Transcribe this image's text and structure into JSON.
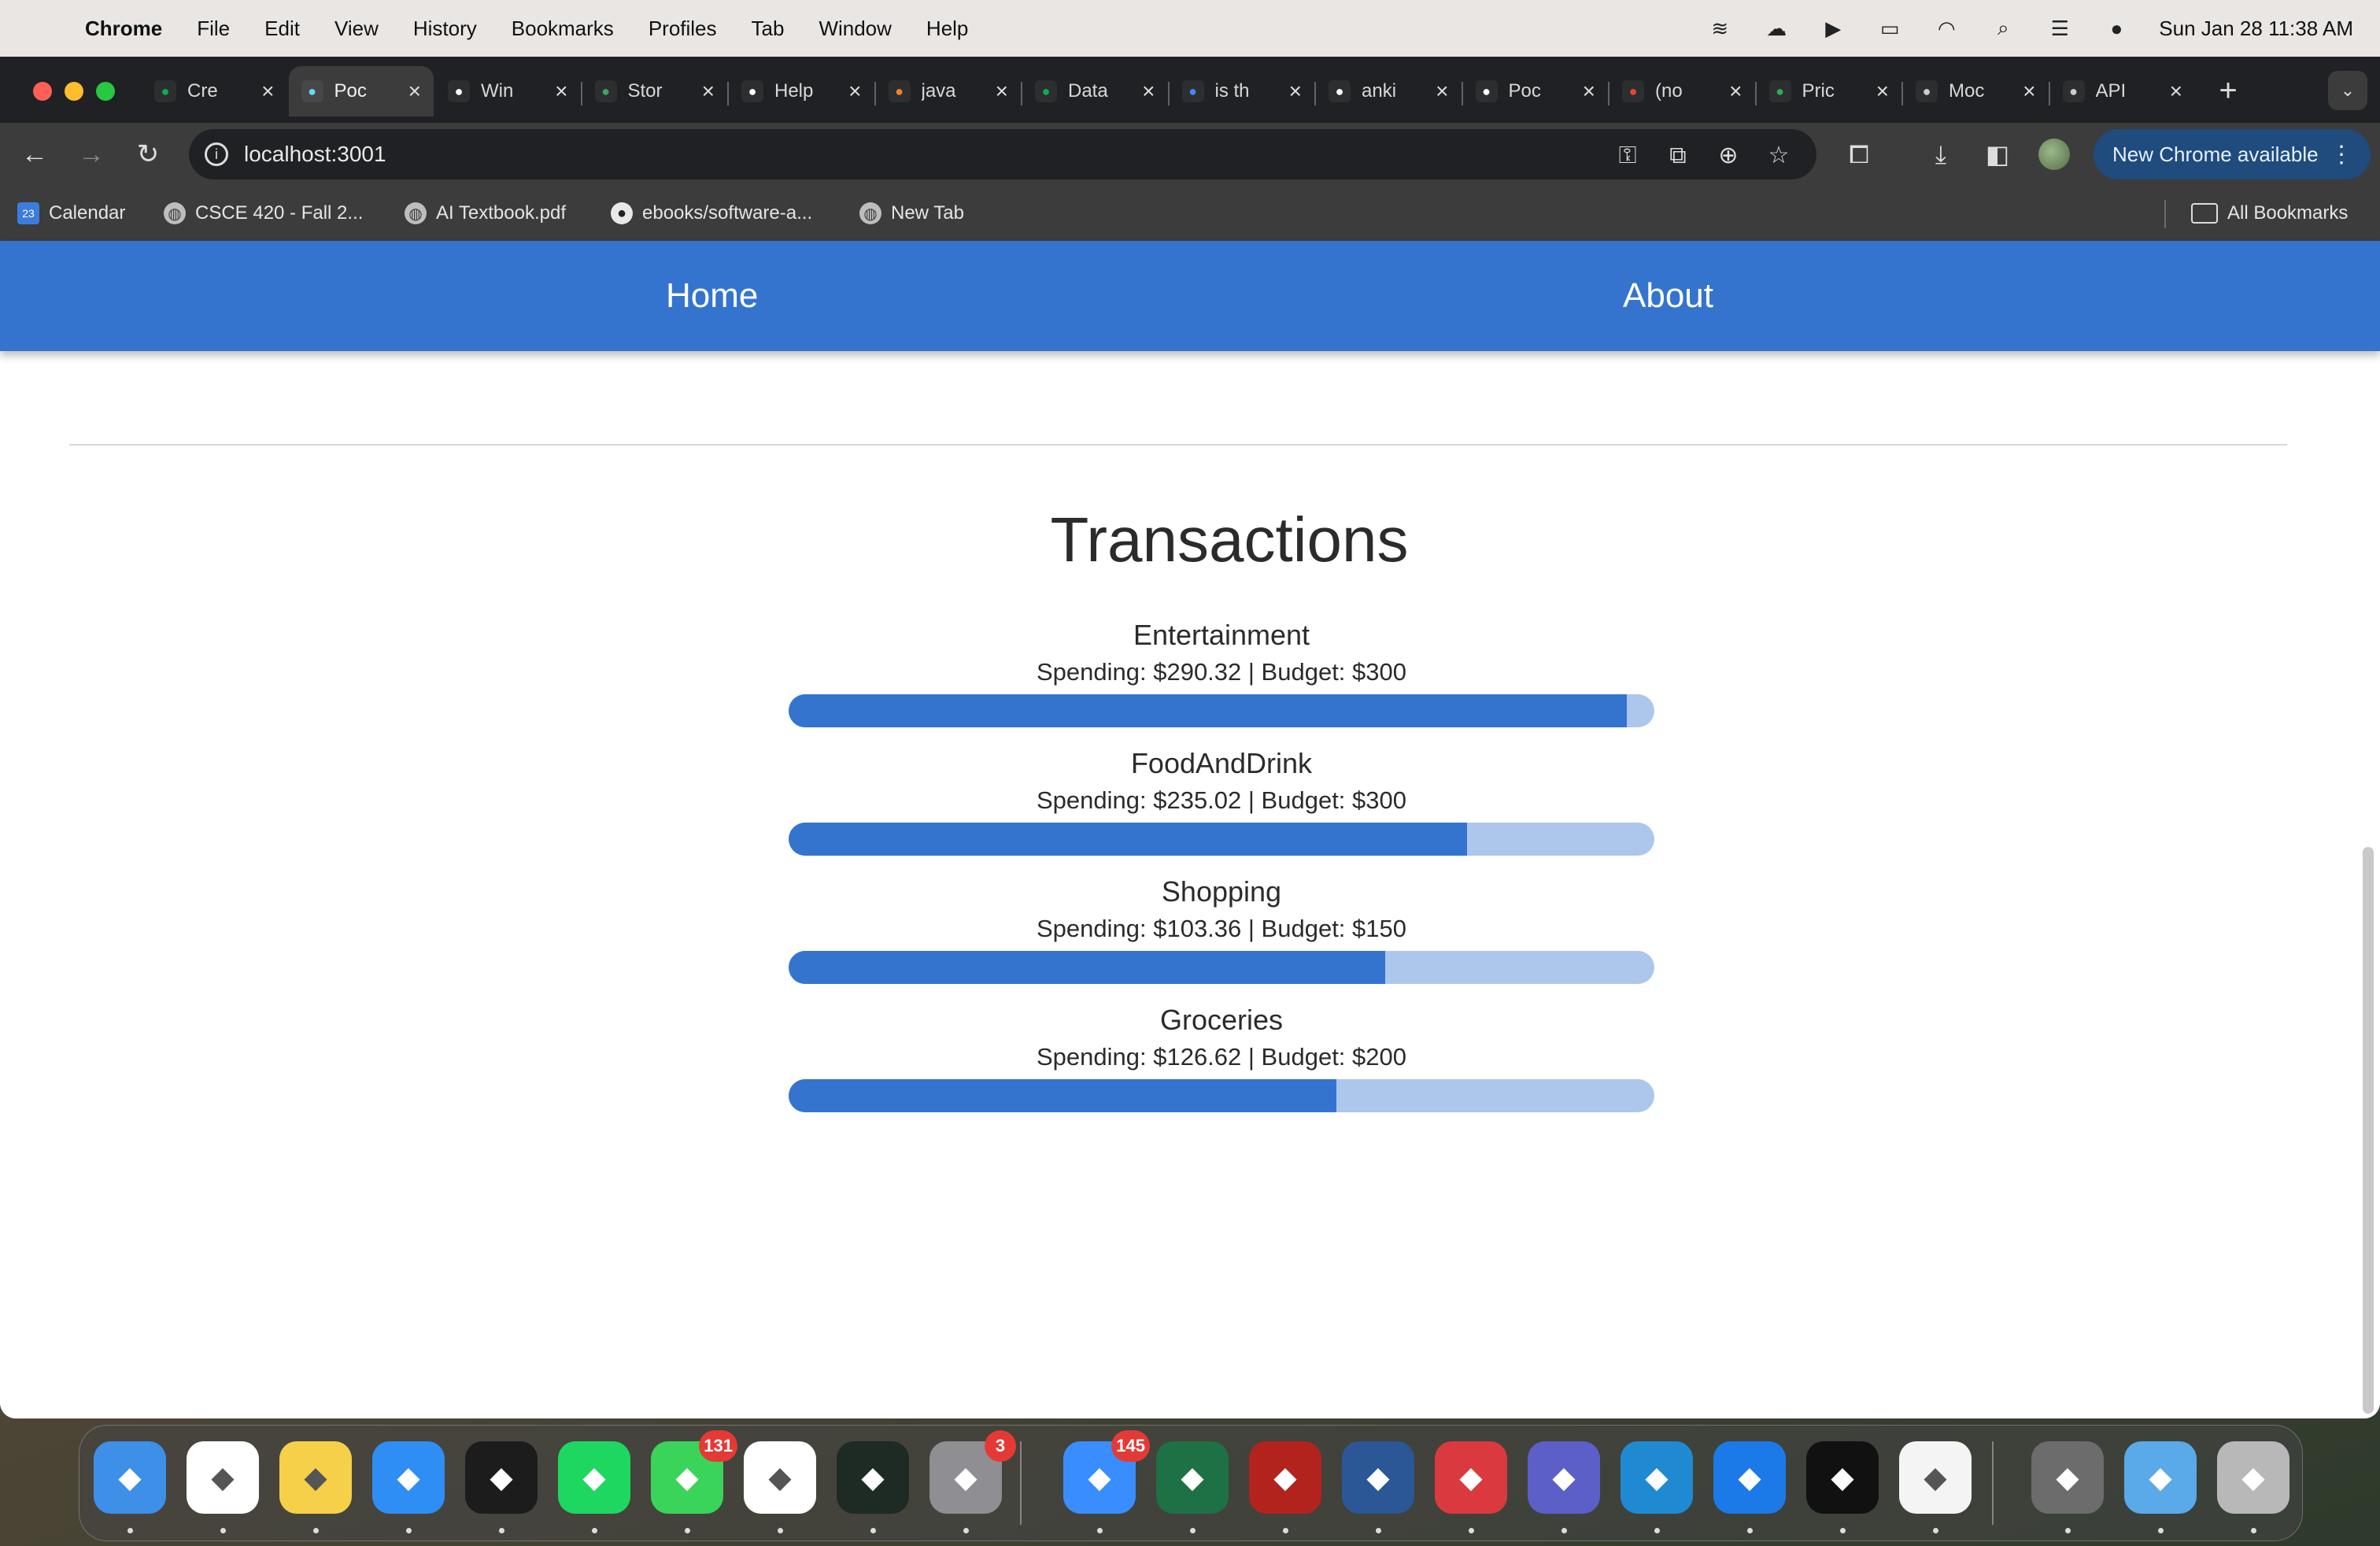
{
  "menubar": {
    "app_name": "Chrome",
    "items": [
      "File",
      "Edit",
      "View",
      "History",
      "Bookmarks",
      "Profiles",
      "Tab",
      "Window",
      "Help"
    ],
    "datetime": "Sun Jan 28  11:38 AM"
  },
  "tabs": [
    {
      "title": "Cre",
      "icon": "mongodb-leaf-icon",
      "color": "#13aa52"
    },
    {
      "title": "Poc",
      "icon": "react-icon",
      "color": "#61dafb",
      "active": true
    },
    {
      "title": "Win",
      "icon": "medium-icon",
      "color": "#ffffff"
    },
    {
      "title": "Stor",
      "icon": "w-logo-icon",
      "color": "#3da35d"
    },
    {
      "title": "Help",
      "icon": "triangle-icon",
      "color": "#ffffff"
    },
    {
      "title": "java",
      "icon": "stackoverflow-icon",
      "color": "#f48024"
    },
    {
      "title": "Data",
      "icon": "mongodb-leaf-icon",
      "color": "#13aa52"
    },
    {
      "title": "is th",
      "icon": "google-icon",
      "color": "#4285f4"
    },
    {
      "title": "anki",
      "icon": "github-icon",
      "color": "#ffffff"
    },
    {
      "title": "Poc",
      "icon": "github-icon",
      "color": "#ffffff"
    },
    {
      "title": "(no",
      "icon": "gmail-icon",
      "color": "#ea4335"
    },
    {
      "title": "Pric",
      "icon": "spreadsheet-icon",
      "color": "#34a853"
    },
    {
      "title": "Moc",
      "icon": "openai-icon",
      "color": "#cccccc"
    },
    {
      "title": "API",
      "icon": "openai-icon",
      "color": "#cccccc"
    }
  ],
  "toolbar": {
    "url": "localhost:3001",
    "update_label": "New Chrome available"
  },
  "bookmarks": [
    {
      "label": "Calendar",
      "icon": "calendar-icon"
    },
    {
      "label": "CSCE 420 - Fall 2...",
      "icon": "globe-icon"
    },
    {
      "label": "AI Textbook.pdf",
      "icon": "globe-icon"
    },
    {
      "label": "ebooks/software-a...",
      "icon": "github-icon"
    },
    {
      "label": "New Tab",
      "icon": "globe-icon"
    }
  ],
  "all_bookmarks": "All Bookmarks",
  "nav": {
    "home": "Home",
    "about": "About"
  },
  "page": {
    "title": "Transactions",
    "categories": [
      {
        "name": "Entertainment",
        "stats": "Spending: $290.32 | Budget: $300",
        "spending": 290.32,
        "budget": 300
      },
      {
        "name": "FoodAndDrink",
        "stats": "Spending: $235.02 | Budget: $300",
        "spending": 235.02,
        "budget": 300
      },
      {
        "name": "Shopping",
        "stats": "Spending: $103.36 | Budget: $150",
        "spending": 103.36,
        "budget": 150
      },
      {
        "name": "Groceries",
        "stats": "Spending: $126.62 | Budget: $200",
        "spending": 126.62,
        "budget": 200
      }
    ]
  },
  "colors": {
    "nav": "#3474cf",
    "bar_fill": "#3474cf",
    "bar_track": "#adc7ec"
  },
  "dock": [
    {
      "name": "finder",
      "icon": "finder-icon",
      "color": "#3d8fe8"
    },
    {
      "name": "chrome",
      "icon": "chrome-icon",
      "color": "#ffffff"
    },
    {
      "name": "notes",
      "icon": "notes-icon",
      "color": "#f7d04a"
    },
    {
      "name": "safari",
      "icon": "safari-icon",
      "color": "#2f8ef3"
    },
    {
      "name": "terminal",
      "icon": "terminal-icon",
      "color": "#1c1c1c"
    },
    {
      "name": "spotify",
      "icon": "spotify-icon",
      "color": "#1ed760"
    },
    {
      "name": "messages",
      "icon": "messages-icon",
      "color": "#3bd45a",
      "badge": "131"
    },
    {
      "name": "photos",
      "icon": "photos-icon",
      "color": "#ffffff"
    },
    {
      "name": "activity-monitor",
      "icon": "activity-monitor-icon",
      "color": "#1e2a24"
    },
    {
      "name": "system-settings",
      "icon": "gear-icon",
      "color": "#8e8e93",
      "badge": "3"
    },
    {
      "name": "mail",
      "icon": "mail-icon",
      "color": "#3a8dff",
      "badge": "145"
    },
    {
      "name": "excel",
      "icon": "excel-icon",
      "color": "#1e7145"
    },
    {
      "name": "acrobat",
      "icon": "acrobat-icon",
      "color": "#b3231e"
    },
    {
      "name": "word",
      "icon": "word-icon",
      "color": "#2b5797"
    },
    {
      "name": "expressvpn",
      "icon": "expressvpn-icon",
      "color": "#da3940"
    },
    {
      "name": "teams",
      "icon": "teams-icon",
      "color": "#5b5fc7"
    },
    {
      "name": "vscode",
      "icon": "vscode-icon",
      "color": "#1f8ad2"
    },
    {
      "name": "xcode",
      "icon": "xcode-icon",
      "color": "#1b7ae8"
    },
    {
      "name": "pycharm",
      "icon": "pycharm-icon",
      "color": "#111111"
    },
    {
      "name": "textedit",
      "icon": "textedit-icon",
      "color": "#f4f4f4"
    },
    {
      "name": "downloads-stack",
      "icon": "album-stack-icon",
      "color": "#6c6c6c"
    },
    {
      "name": "folder",
      "icon": "folder-icon",
      "color": "#5aa9e8"
    },
    {
      "name": "trash",
      "icon": "trash-icon",
      "color": "#b8b8b8"
    }
  ]
}
